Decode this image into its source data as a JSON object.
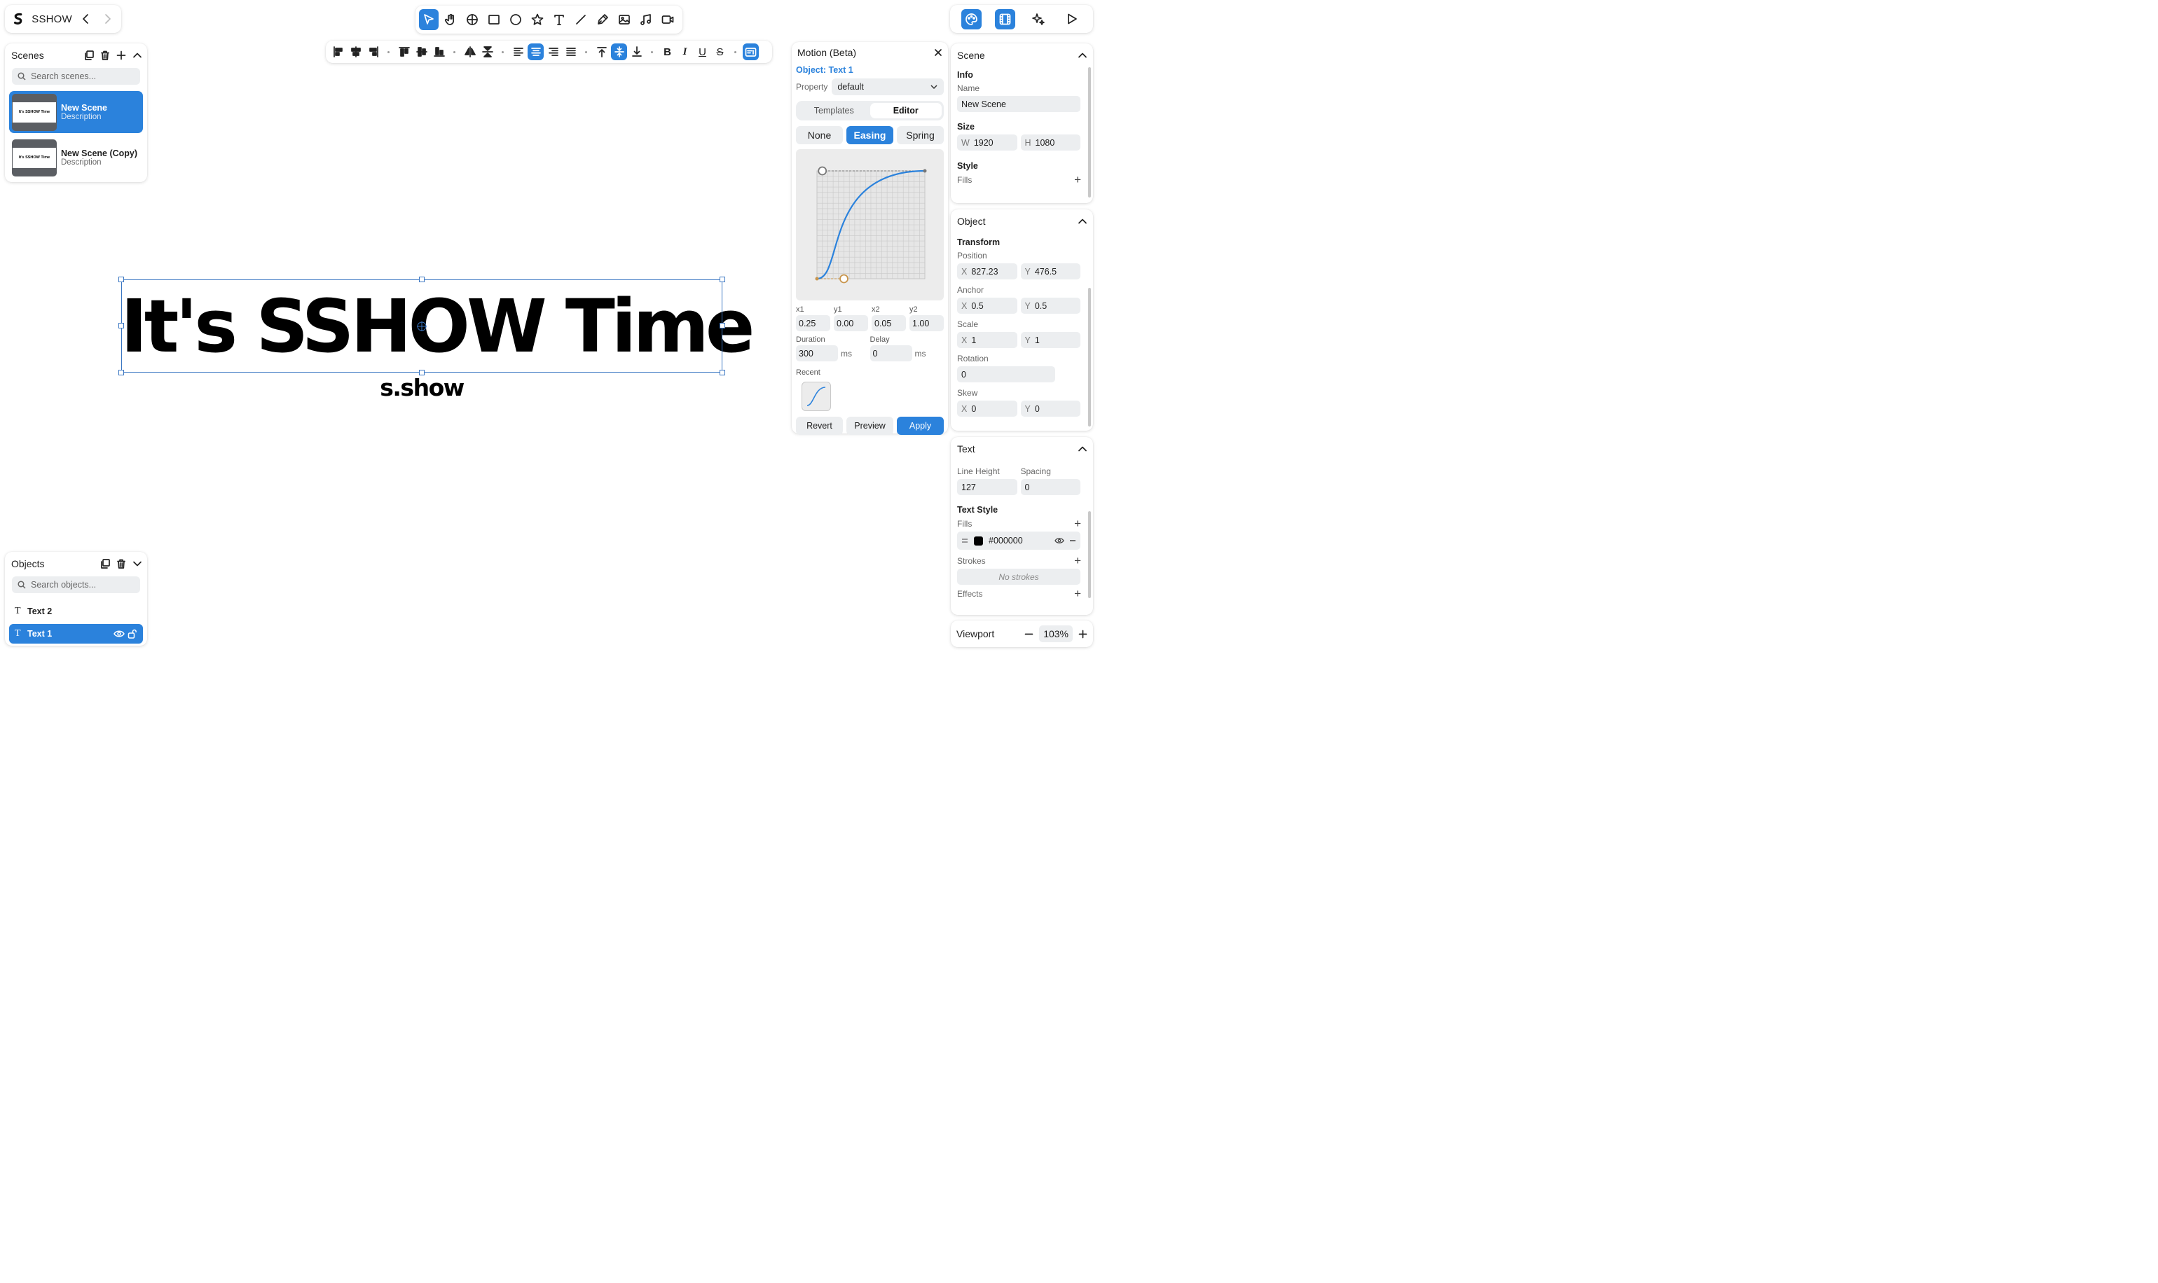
{
  "app": {
    "name": "SSHOW"
  },
  "format_toolbar": {
    "bold": "B",
    "italic": "I",
    "underline": "U",
    "strike": "S"
  },
  "scenes": {
    "title": "Scenes",
    "search_placeholder": "Search scenes...",
    "items": [
      {
        "name": "New Scene",
        "description": "Description",
        "thumb_text": "It's SSHOW Time"
      },
      {
        "name": "New Scene (Copy)",
        "description": "Description",
        "thumb_text": "It's SSHOW Time"
      }
    ]
  },
  "objects": {
    "title": "Objects",
    "search_placeholder": "Search objects...",
    "items": [
      {
        "name": "Text 2",
        "icon": "T"
      },
      {
        "name": "Text 1",
        "icon": "T"
      }
    ]
  },
  "canvas": {
    "headline": "It's SSHOW Time",
    "subline": "s.show"
  },
  "motion": {
    "title": "Motion (Beta)",
    "object_label": "Object: Text 1",
    "property_label": "Property",
    "property_value": "default",
    "tabs": [
      "Templates",
      "Editor"
    ],
    "modes": [
      "None",
      "Easing",
      "Spring"
    ],
    "bezier": {
      "x1_label": "x1",
      "y1_label": "y1",
      "x2_label": "x2",
      "y2_label": "y2",
      "x1": "0.25",
      "y1": "0.00",
      "x2": "0.05",
      "y2": "1.00"
    },
    "duration_label": "Duration",
    "duration": "300",
    "delay_label": "Delay",
    "delay": "0",
    "unit": "ms",
    "recent_label": "Recent",
    "buttons": {
      "revert": "Revert",
      "preview": "Preview",
      "apply": "Apply"
    }
  },
  "scene_panel": {
    "title": "Scene",
    "info": "Info",
    "name_label": "Name",
    "name_value": "New Scene",
    "size": "Size",
    "w_key": "W",
    "w": "1920",
    "h_key": "H",
    "h": "1080",
    "style": "Style",
    "fills": "Fills"
  },
  "object_panel": {
    "title": "Object",
    "transform": "Transform",
    "position": "Position",
    "pos_x": "827.23",
    "pos_y": "476.5",
    "anchor": "Anchor",
    "anchor_x": "0.5",
    "anchor_y": "0.5",
    "scale": "Scale",
    "scale_x": "1",
    "scale_y": "1",
    "rotation": "Rotation",
    "rotation_value": "0",
    "skew": "Skew",
    "skew_x": "0",
    "skew_y": "0",
    "x_key": "X",
    "y_key": "Y"
  },
  "text_panel": {
    "title": "Text",
    "line_height": "Line Height",
    "line_height_value": "127",
    "spacing": "Spacing",
    "spacing_value": "0",
    "text_style": "Text Style",
    "fills": "Fills",
    "fill_color": "#000000",
    "strokes": "Strokes",
    "no_strokes": "No strokes",
    "effects": "Effects"
  },
  "viewport": {
    "label": "Viewport",
    "zoom": "103%"
  },
  "colors": {
    "accent": "#2b82dc",
    "curve": "#2b82dc",
    "handle": "#c8954c"
  }
}
